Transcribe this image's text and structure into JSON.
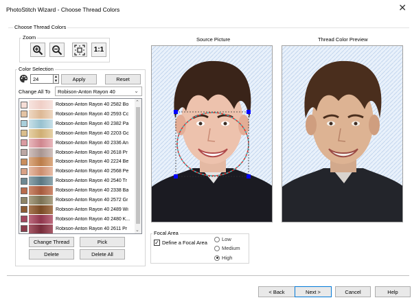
{
  "window": {
    "title": "PhotoStitch Wizard - Choose Thread Colors",
    "close_glyph": "✕"
  },
  "section_title": "Choose Thread Colors",
  "zoom": {
    "label": "Zoom",
    "buttons": [
      {
        "name": "zoom-in-icon"
      },
      {
        "name": "zoom-out-icon"
      },
      {
        "name": "fit-icon"
      },
      {
        "name": "actual-size-icon",
        "text": "1:1"
      }
    ]
  },
  "color_selection": {
    "label": "Color Selection",
    "count": "24",
    "apply_label": "Apply",
    "reset_label": "Reset",
    "change_all_label": "Change All To",
    "change_all_value": "Robison-Anton Rayon 40"
  },
  "threads": [
    {
      "name": "Robison-Anton Rayon 40 2582 Bo",
      "color": "#f5ddd6",
      "grad": [
        "#f7e4df",
        "#f0cfc7"
      ]
    },
    {
      "name": "Robison-Anton Rayon 40 2593 Cc",
      "color": "#e3c3a4",
      "grad": [
        "#eed8c3",
        "#ddb895"
      ]
    },
    {
      "name": "Robison-Anton Rayon 40 2382 Pa",
      "color": "#a9cfdb",
      "grad": [
        "#c8e1e9",
        "#98c1cf"
      ]
    },
    {
      "name": "Robison-Anton Rayon 40 2203 Gc",
      "color": "#d9be8c",
      "grad": [
        "#e6d1a6",
        "#cfae74"
      ]
    },
    {
      "name": "Robison-Anton Rayon 40 2336 An",
      "color": "#d99aa1",
      "grad": [
        "#e9b8bd",
        "#cf868e"
      ]
    },
    {
      "name": "Robison-Anton Rayon 40 2618 Pr",
      "color": "#bba7a3",
      "grad": [
        "#d0c1be",
        "#a89591"
      ]
    },
    {
      "name": "Robison-Anton Rayon 40 2224 Be",
      "color": "#c98e5c",
      "grad": [
        "#dcab83",
        "#bb7c49"
      ]
    },
    {
      "name": "Robison-Anton Rayon 40 2568 Pe",
      "color": "#d8a185",
      "grad": [
        "#e7bda7",
        "#cc8d6e"
      ]
    },
    {
      "name": "Robison-Anton Rayon 40 2540 Tr",
      "color": "#6d8993",
      "grad": [
        "#8ea6ae",
        "#5a7782"
      ]
    },
    {
      "name": "Robison-Anton Rayon 40 2338 Ba",
      "color": "#b86b4c",
      "grad": [
        "#cc8a6e",
        "#a55a3d"
      ]
    },
    {
      "name": "Robison-Anton Rayon 40 2572 Gr",
      "color": "#8e8466",
      "grad": [
        "#aba286",
        "#7a7154"
      ]
    },
    {
      "name": "Robison-Anton Rayon 40 2489 Wi",
      "color": "#8c5a33",
      "grad": [
        "#a97a55",
        "#794a25"
      ]
    },
    {
      "name": "Robison-Anton Rayon 40 2480 K...",
      "color": "#a3475d",
      "grad": [
        "#bd6c7f",
        "#8f364c"
      ]
    },
    {
      "name": "Robison-Anton Rayon 40 2611 Pr",
      "color": "#8b3b4a",
      "grad": [
        "#a85b69",
        "#772c3a"
      ]
    }
  ],
  "list_actions": {
    "change_thread": "Change Thread",
    "pick": "Pick",
    "delete": "Delete",
    "delete_all": "Delete All"
  },
  "source_picture": {
    "label": "Source Picture"
  },
  "preview_picture": {
    "label": "Thread Color Preview"
  },
  "focal_area": {
    "label": "Focal Area",
    "define_label": "Define a Focal Area",
    "define_checked": true,
    "levels": [
      "Low",
      "Medium",
      "High"
    ],
    "selected": "High"
  },
  "footer": {
    "back": "< Back",
    "next": "Next >",
    "cancel": "Cancel",
    "help": "Help"
  },
  "colors": {
    "accent": "#0078d7",
    "focal_handle": "#0000ff",
    "focal_ellipse": "#e03030"
  }
}
